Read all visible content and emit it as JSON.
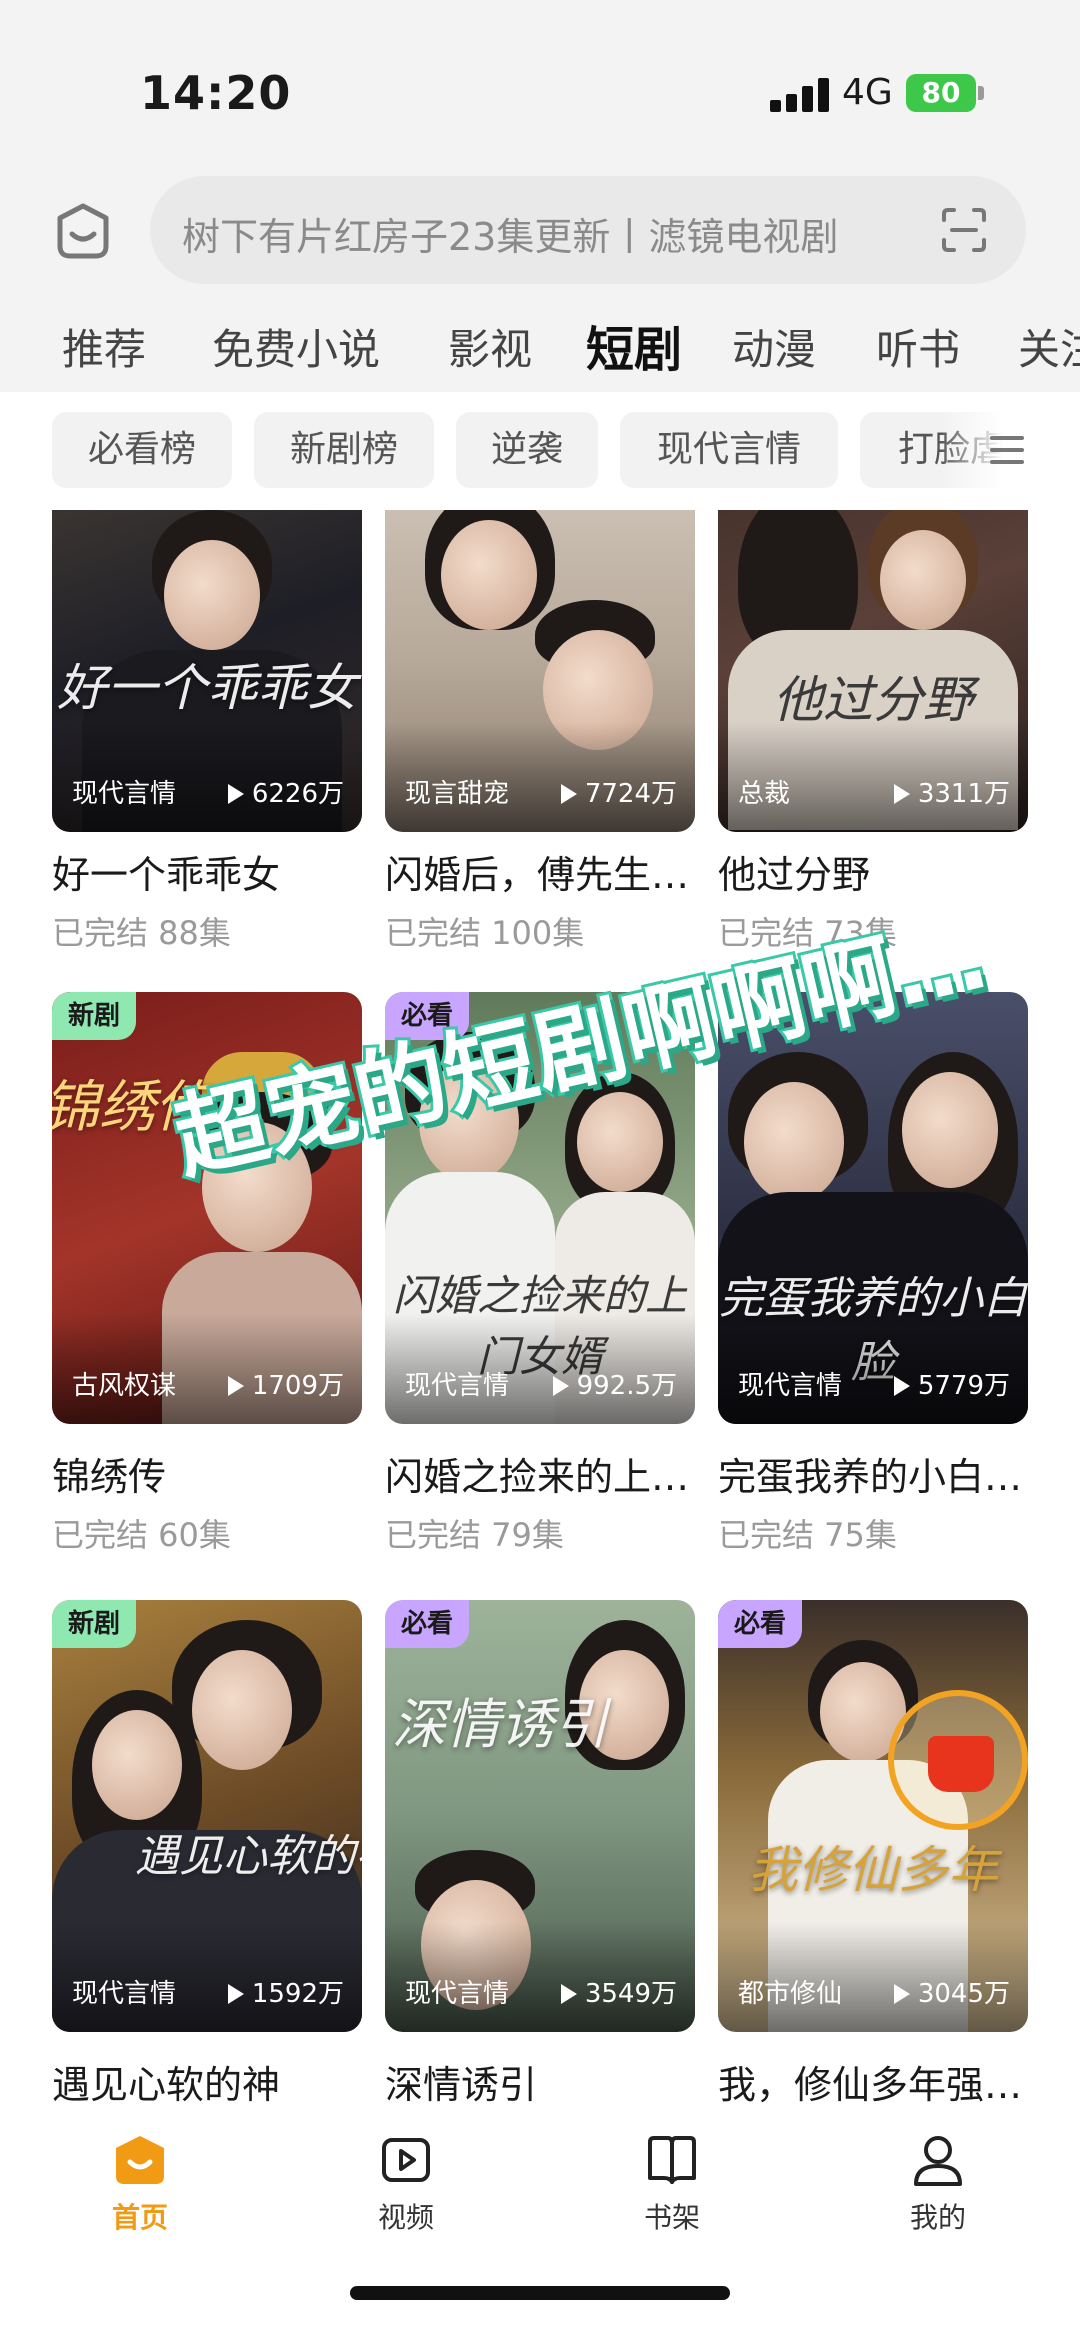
{
  "status_bar": {
    "time": "14:20",
    "network": "4G",
    "battery": "80"
  },
  "search": {
    "placeholder": "树下有片红房子23集更新丨滤镜电视剧"
  },
  "tabs": [
    {
      "label": "推荐"
    },
    {
      "label": "免费小说"
    },
    {
      "label": "影视"
    },
    {
      "label": "短剧",
      "active": true
    },
    {
      "label": "动漫"
    },
    {
      "label": "听书"
    },
    {
      "label": "关注"
    }
  ],
  "chips": [
    {
      "label": "必看榜"
    },
    {
      "label": "新剧榜"
    },
    {
      "label": "逆袭"
    },
    {
      "label": "现代言情"
    },
    {
      "label": "打脸虐渣"
    }
  ],
  "cards": [
    {
      "name": "好一个乖乖女",
      "meta": "已完结 88集",
      "genre": "现代言情",
      "plays": "6226万",
      "poster_text": "好一个乖乖女",
      "badge": ""
    },
    {
      "name": "闪婚后，傅先生…",
      "meta": "已完结 100集",
      "genre": "现言甜宠",
      "plays": "7724万",
      "poster_text": "",
      "badge": ""
    },
    {
      "name": "他过分野",
      "meta": "已完结 73集",
      "genre": "总裁",
      "plays": "3311万",
      "poster_text": "他过分野",
      "badge": ""
    },
    {
      "name": "锦绣传",
      "meta": "已完结 60集",
      "genre": "古风权谋",
      "plays": "1709万",
      "poster_text": "锦绣传",
      "badge": "新剧"
    },
    {
      "name": "闪婚之捡来的上…",
      "meta": "已完结 79集",
      "genre": "现代言情",
      "plays": "992.5万",
      "poster_text": "闪婚之捡来的上门女婿",
      "badge": "必看"
    },
    {
      "name": "完蛋我养的小白…",
      "meta": "已完结 75集",
      "genre": "现代言情",
      "plays": "5779万",
      "poster_text": "完蛋我养的小白脸",
      "badge": ""
    },
    {
      "name": "遇见心软的神",
      "meta": "",
      "genre": "现代言情",
      "plays": "1592万",
      "poster_text": "遇见心软的神",
      "badge": "新剧"
    },
    {
      "name": "深情诱引",
      "meta": "",
      "genre": "现代言情",
      "plays": "3549万",
      "poster_text": "深情诱引",
      "badge": "必看"
    },
    {
      "name": "我，修仙多年强…",
      "meta": "",
      "genre": "都市修仙",
      "plays": "3045万",
      "poster_text": "我修仙多年",
      "badge": "必看"
    }
  ],
  "overlay": {
    "text": "超宠的短剧啊啊啊…"
  },
  "bottom_nav": [
    {
      "label": "首页",
      "icon": "home-icon",
      "active": true
    },
    {
      "label": "视频",
      "icon": "video-play-icon"
    },
    {
      "label": "书架",
      "icon": "bookshelf-icon"
    },
    {
      "label": "我的",
      "icon": "profile-icon"
    }
  ],
  "colors": {
    "accent": "#f19a14",
    "badge_new": "#8fe8b0",
    "badge_must": "#c8a6ff",
    "battery": "#3ec84a"
  }
}
